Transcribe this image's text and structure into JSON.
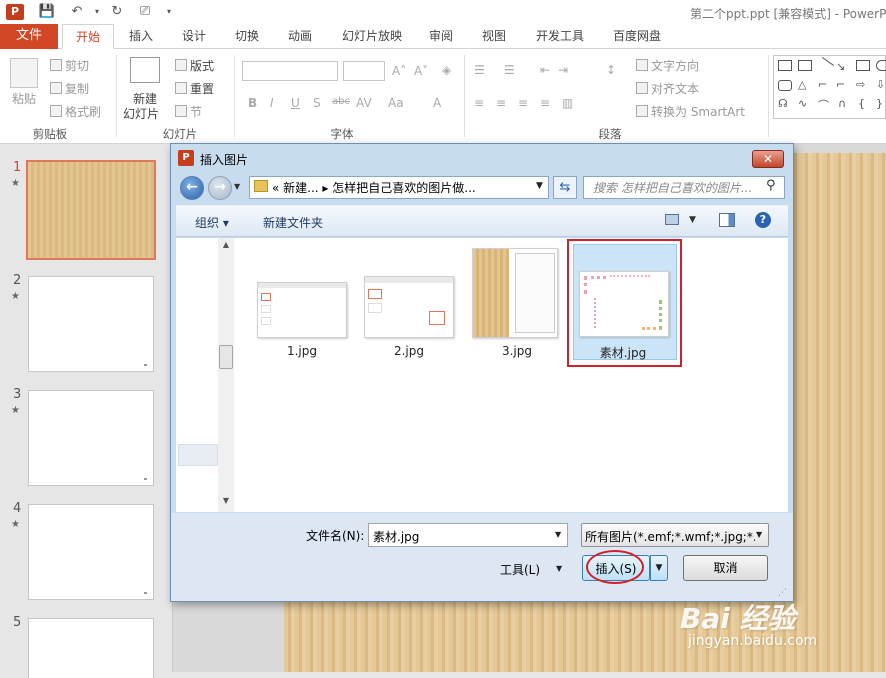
{
  "app": {
    "doc_title": "第二个ppt.ppt [兼容模式] - PowerP",
    "app_icon": "P"
  },
  "tabs": [
    "文件",
    "开始",
    "插入",
    "设计",
    "切换",
    "动画",
    "幻灯片放映",
    "审阅",
    "视图",
    "开发工具",
    "百度网盘"
  ],
  "ribbon": {
    "clipboard": {
      "paste": "粘贴",
      "cut": "剪切",
      "copy": "复制",
      "format_painter": "格式刷",
      "label": "剪贴板"
    },
    "slides": {
      "new_slide_line1": "新建",
      "new_slide_line2": "幻灯片",
      "layout": "版式",
      "reset": "重置",
      "section": "节",
      "label": "幻灯片"
    },
    "font": {
      "label": "字体",
      "bold": "B",
      "italic": "I",
      "underline": "U",
      "shadow": "S",
      "strike": "abc",
      "spacing": "AV",
      "case": "Aa",
      "color": "A"
    },
    "paragraph": {
      "text_direction": "文字方向",
      "align_text": "对齐文本",
      "smartart": "转换为 SmartArt",
      "label": "段落"
    }
  },
  "slides_pane": {
    "numbers": [
      "1",
      "2",
      "3",
      "4",
      "5"
    ],
    "star": "★"
  },
  "dialog": {
    "title": "插入图片",
    "close": "✕",
    "address": "« 新建... ▸ 怎样把自己喜欢的图片做...",
    "search_placeholder": "搜索 怎样把自己喜欢的图片...",
    "organize": "组织 ▾",
    "new_folder": "新建文件夹",
    "help": "?",
    "files": [
      {
        "name": "1.jpg"
      },
      {
        "name": "2.jpg"
      },
      {
        "name": "3.jpg"
      },
      {
        "name": "素材.jpg",
        "selected": true
      }
    ],
    "filename_label": "文件名(N):",
    "filename_value": "素材.jpg",
    "filetype_value": "所有图片(*.emf;*.wmf;*.jpg;*.jp",
    "tools": "工具(L)",
    "insert": "插入(S)",
    "cancel": "取消"
  },
  "watermark": {
    "main": "Bai 经验",
    "sub": "jingyan.baidu.com"
  },
  "colors": {
    "accent": "#d24726",
    "highlight": "#d0202a",
    "selection": "#cce4f7"
  }
}
